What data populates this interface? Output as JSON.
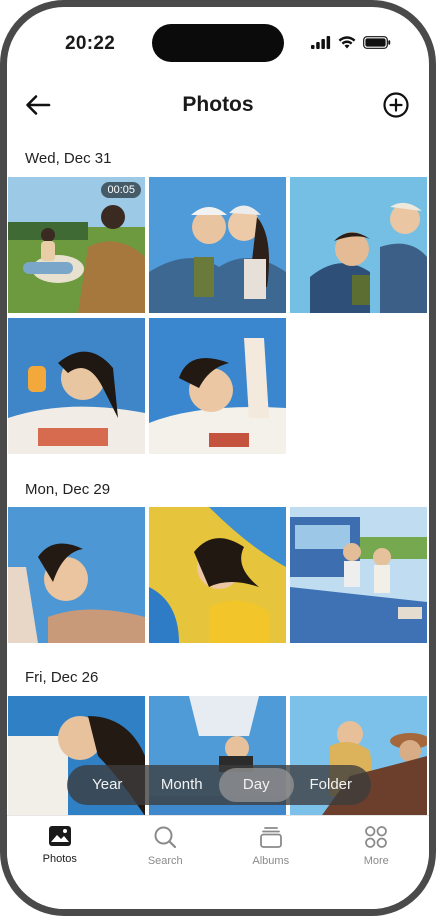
{
  "status_bar": {
    "time": "20:22"
  },
  "header": {
    "title": "Photos"
  },
  "sections": [
    {
      "label": "Wed, Dec 31"
    },
    {
      "label": "Mon, Dec 29"
    },
    {
      "label": "Fri, Dec 26"
    }
  ],
  "video_duration": "00:05",
  "view_modes": [
    {
      "label": "Year",
      "selected": false
    },
    {
      "label": "Month",
      "selected": false
    },
    {
      "label": "Day",
      "selected": true
    },
    {
      "label": "Folder",
      "selected": false
    }
  ],
  "tabs": [
    {
      "label": "Photos",
      "icon": "photos-icon",
      "selected": true
    },
    {
      "label": "Search",
      "icon": "search-icon",
      "selected": false
    },
    {
      "label": "Albums",
      "icon": "albums-icon",
      "selected": false
    },
    {
      "label": "More",
      "icon": "more-grid-icon",
      "selected": false
    }
  ],
  "colors": {
    "accent": "#1a1a1a",
    "inactive": "#8a8a8a",
    "sky": "#3f8fd0"
  }
}
